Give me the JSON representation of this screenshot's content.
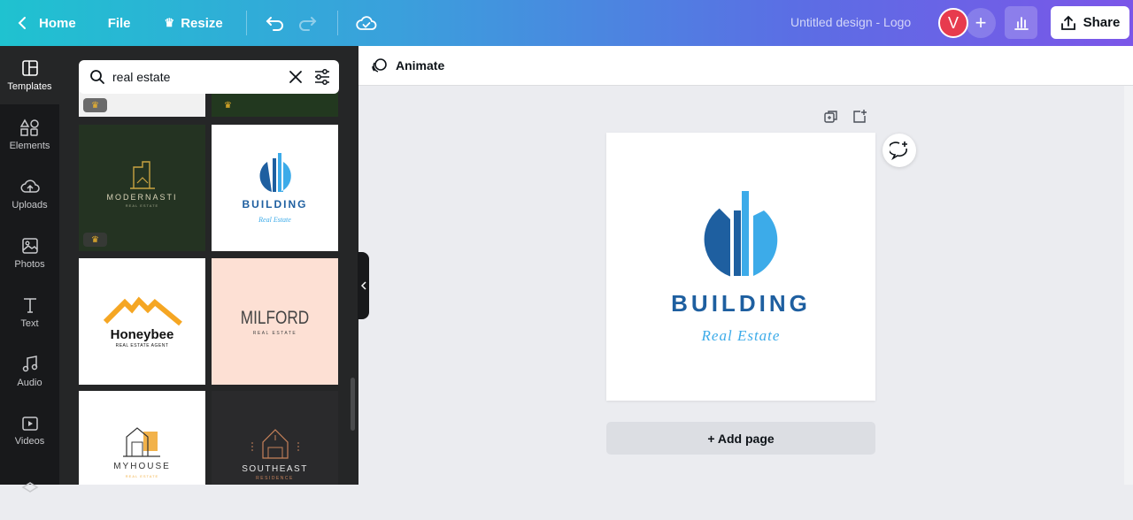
{
  "topbar": {
    "home": "Home",
    "file": "File",
    "resize": "Resize",
    "title": "Untitled design - Logo",
    "avatar_initial": "V",
    "add_member": "+",
    "share": "Share"
  },
  "rail": [
    {
      "label": "Templates",
      "icon": "templates-icon"
    },
    {
      "label": "Elements",
      "icon": "elements-icon"
    },
    {
      "label": "Uploads",
      "icon": "uploads-icon"
    },
    {
      "label": "Photos",
      "icon": "photos-icon"
    },
    {
      "label": "Text",
      "icon": "text-icon"
    },
    {
      "label": "Audio",
      "icon": "audio-icon"
    },
    {
      "label": "Videos",
      "icon": "videos-icon"
    }
  ],
  "search": {
    "value": "real estate"
  },
  "templates": [
    {
      "brand": "MODERNASTI",
      "tagline": "REAL ESTATE"
    },
    {
      "brand": "BUILDING",
      "tagline": "Real Estate"
    },
    {
      "brand": "Honeybee",
      "tagline": "REAL ESTATE AGENT"
    },
    {
      "brand": "MILFORD",
      "tagline": "REAL ESTATE"
    },
    {
      "brand": "MYHOUSE",
      "tagline": "REAL ESTATE"
    },
    {
      "brand": "SOUTHEAST",
      "tagline": "RESIDENCE"
    }
  ],
  "canvas": {
    "animate": "Animate",
    "logo_title": "BUILDING",
    "logo_subtitle": "Real Estate",
    "add_page": "+ Add page"
  },
  "colors": {
    "accent_blue": "#1e5fa0",
    "light_blue": "#3cabe9",
    "honey": "#f5a623"
  }
}
